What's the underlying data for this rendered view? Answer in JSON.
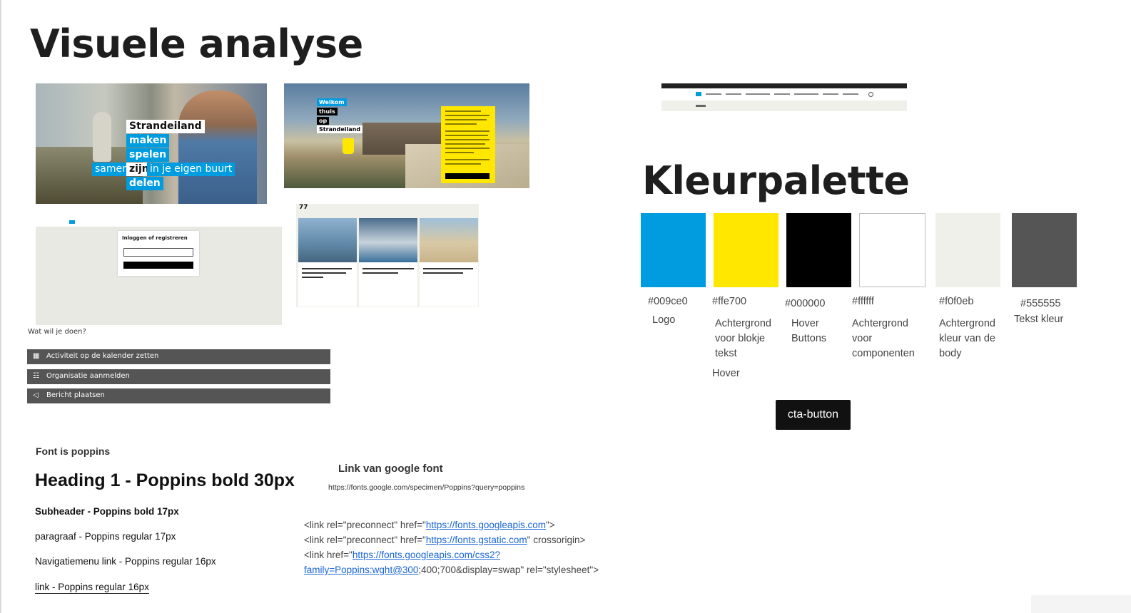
{
  "page": {
    "title": "Visuele analyse",
    "palette_title": "Kleurpalette"
  },
  "screens": {
    "hero": {
      "tags": [
        "Strandeiland",
        "maken",
        "spelen",
        "samen",
        "zijn",
        "in je eigen buurt",
        "delen"
      ]
    },
    "welcome": {
      "tags": [
        "Welkom",
        "thuis",
        "op",
        "Strandeiland"
      ]
    },
    "login": {
      "title": "Inloggen of registreren"
    },
    "news": {
      "count": "77"
    },
    "actions": {
      "question": "Wat wil je doen?",
      "items": [
        {
          "icon": "calendar-icon",
          "glyph": "▦",
          "label": "Activiteit op de kalender zetten"
        },
        {
          "icon": "people-icon",
          "glyph": "☷",
          "label": "Organisatie aanmelden"
        },
        {
          "icon": "megaphone-icon",
          "glyph": "◁",
          "label": "Bericht plaatsen"
        }
      ]
    }
  },
  "fonts": {
    "intro": "Font is poppins",
    "heading": "Heading  1 - Poppins bold 30px",
    "subheader": "Subheader - Poppins bold 17px",
    "paragraph": "paragraaf -  Poppins regular 17px",
    "nav": "Navigatiemenu link  - Poppins regular 16px",
    "link": "link  - Poppins regular 16px",
    "google_title": "Link van google font",
    "google_url": "https://fonts.google.com/specimen/Poppins?query=poppins",
    "code": {
      "l1_a": "<link rel=\"preconnect\" href=\"",
      "l1_link": "https://fonts.googleapis.com",
      "l1_b": "\">",
      "l2_a": "<link rel=\"preconnect\" href=\"",
      "l2_link": "https://fonts.gstatic.com",
      "l2_b": "\" crossorigin>",
      "l3_a": "<link href=\"",
      "l3_link": "https://fonts.googleapis.com/css2?",
      "l4_link": "family=Poppins:wght@300",
      "l4_b": ";400;700&display=swap\" rel=\"stylesheet\">"
    }
  },
  "palette": [
    {
      "hex": "#009ce0",
      "desc": "Logo"
    },
    {
      "hex": "#ffe700",
      "desc": "Achtergrond voor blokje tekst",
      "extra": "Hover"
    },
    {
      "hex": "#000000",
      "desc": "Hover Buttons"
    },
    {
      "hex": "#ffffff",
      "desc": "Achtergrond voor componenten"
    },
    {
      "hex": "#f0f0eb",
      "desc": "Achtergrond kleur van de body"
    },
    {
      "hex": "#555555",
      "desc": "Tekst kleur"
    }
  ],
  "cta": {
    "label": "cta-button"
  }
}
